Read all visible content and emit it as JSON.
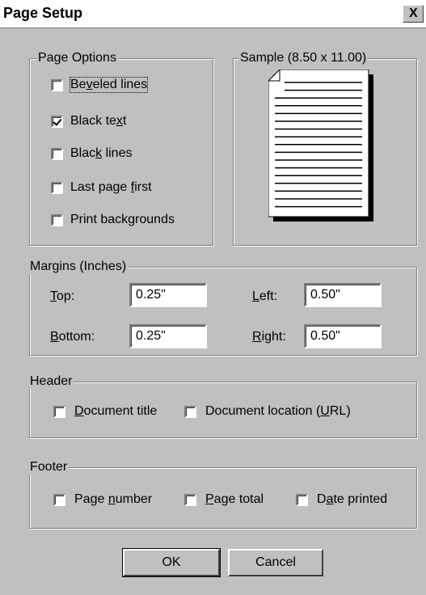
{
  "window": {
    "title": "Page Setup",
    "close_label": "X"
  },
  "page_options": {
    "legend": "Page Options",
    "items": [
      {
        "pre": "Be",
        "ul": "v",
        "post": "eled lines",
        "checked": false
      },
      {
        "pre": "Black te",
        "ul": "x",
        "post": "t",
        "checked": true
      },
      {
        "pre": "Blac",
        "ul": "k",
        "post": " lines",
        "checked": false
      },
      {
        "pre": "Last page ",
        "ul": "f",
        "post": "irst",
        "checked": false
      },
      {
        "pre": "Print backgrounds",
        "ul": "",
        "post": "",
        "checked": false
      }
    ]
  },
  "sample": {
    "legend": "Sample (8.50 x 11.00)"
  },
  "margins": {
    "legend": "Margins (Inches)",
    "top": {
      "ul": "T",
      "rest": "op:",
      "value": "0.25\""
    },
    "bottom": {
      "ul": "B",
      "rest": "ottom:",
      "value": "0.25\""
    },
    "left": {
      "ul": "L",
      "rest": "eft:",
      "value": "0.50\""
    },
    "right": {
      "ul": "R",
      "rest": "ight:",
      "value": "0.50\""
    }
  },
  "header": {
    "legend": "Header",
    "doc_title": {
      "pre": "",
      "ul": "D",
      "post": "ocument title",
      "checked": false
    },
    "doc_location": {
      "pre": "Document location (",
      "ul": "U",
      "post": "RL)",
      "checked": false
    }
  },
  "footer": {
    "legend": "Footer",
    "page_number": {
      "pre": "Page ",
      "ul": "n",
      "post": "umber",
      "checked": false
    },
    "page_total": {
      "pre": "",
      "ul": "P",
      "post": "age total",
      "checked": false
    },
    "date_printed": {
      "pre": "D",
      "ul": "a",
      "post": "te printed",
      "checked": false
    }
  },
  "buttons": {
    "ok": "OK",
    "cancel": "Cancel"
  }
}
